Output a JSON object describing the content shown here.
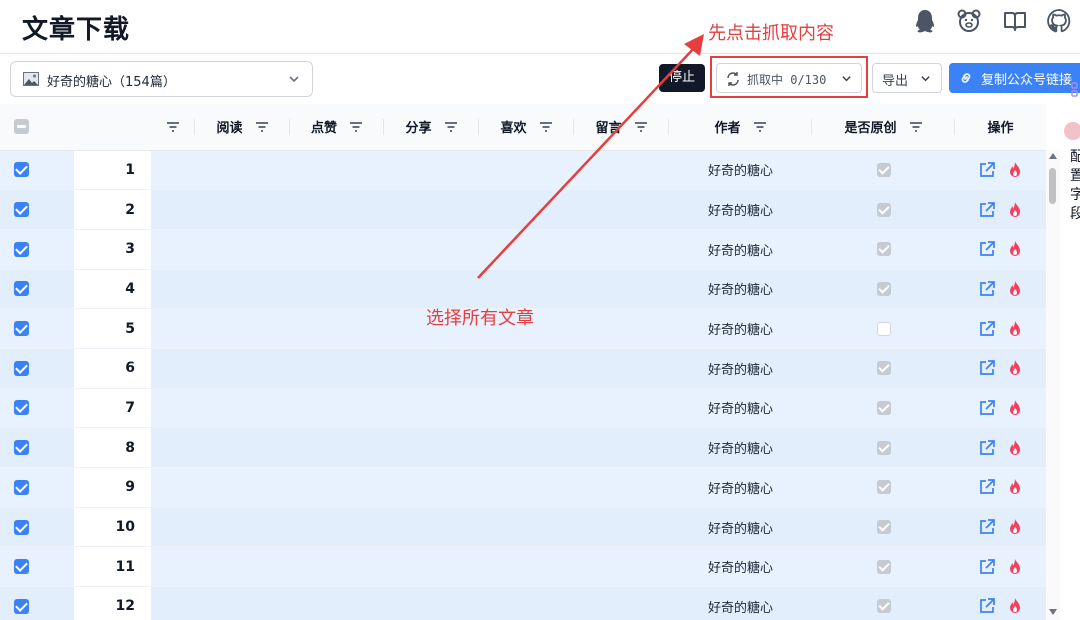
{
  "header": {
    "title": "文章下载"
  },
  "toolbar": {
    "account_name": "好奇的糖心（154篇）",
    "stop_label": "停止",
    "fetch_label": "抓取中 0/130",
    "export_label": "导出",
    "copy_label": "复制公众号链接"
  },
  "table": {
    "columns": [
      "",
      "",
      "",
      "阅读",
      "点赞",
      "分享",
      "喜欢",
      "留言",
      "作者",
      "是否原创",
      "操作"
    ],
    "rows": [
      {
        "index": "1",
        "author": "好奇的糖心",
        "original": true
      },
      {
        "index": "2",
        "author": "好奇的糖心",
        "original": true
      },
      {
        "index": "3",
        "author": "好奇的糖心",
        "original": true
      },
      {
        "index": "4",
        "author": "好奇的糖心",
        "original": true
      },
      {
        "index": "5",
        "author": "好奇的糖心",
        "original": false
      },
      {
        "index": "6",
        "author": "好奇的糖心",
        "original": true
      },
      {
        "index": "7",
        "author": "好奇的糖心",
        "original": true
      },
      {
        "index": "8",
        "author": "好奇的糖心",
        "original": true
      },
      {
        "index": "9",
        "author": "好奇的糖心",
        "original": true
      },
      {
        "index": "10",
        "author": "好奇的糖心",
        "original": true
      },
      {
        "index": "11",
        "author": "好奇的糖心",
        "original": true
      },
      {
        "index": "12",
        "author": "好奇的糖心",
        "original": true
      }
    ]
  },
  "side_panel": {
    "text": "配置字段"
  },
  "annotations": {
    "fetch_hint": "先点击抓取内容",
    "select_hint": "选择所有文章"
  },
  "colors": {
    "accent": "#3b82f6",
    "annotation": "#e53e3e",
    "row_bg": "#e8f2fe"
  },
  "icons": {
    "header": [
      "qq-icon",
      "bear-icon",
      "book-icon",
      "github-icon"
    ],
    "row_actions": [
      "external-link-icon",
      "fire-icon"
    ]
  }
}
